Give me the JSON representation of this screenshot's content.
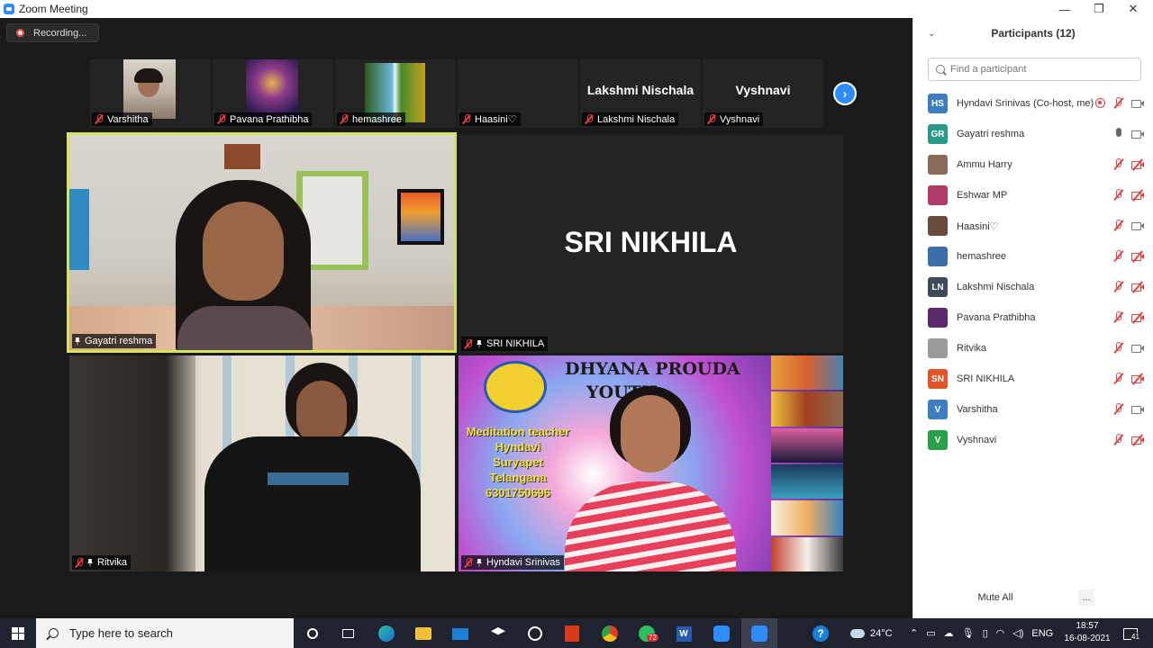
{
  "window": {
    "title": "Zoom Meeting"
  },
  "recording": {
    "label": "Recording..."
  },
  "strip": [
    {
      "name": "Varshitha",
      "type": "video",
      "color": "#b9b2a8"
    },
    {
      "name": "Pavana Prathibha",
      "type": "image",
      "color": "#5b3c82"
    },
    {
      "name": "hemashree",
      "type": "image",
      "color": "#3b7d3a"
    },
    {
      "name": "Haasini♡",
      "type": "blank",
      "color": "#232323"
    },
    {
      "name": "Lakshmi Nischala",
      "type": "text",
      "display": "Lakshmi Nischala"
    },
    {
      "name": "Vyshnavi",
      "type": "text",
      "display": "Vyshnavi"
    }
  ],
  "videos": {
    "gayatri": {
      "name": "Gayatri reshma"
    },
    "sri_nikhila": {
      "name": "SRI NIKHILA",
      "display": "SRI NIKHILA"
    },
    "ritvika": {
      "name": "Ritvika"
    },
    "hyndavi": {
      "name": "Hyndavi Srinivas",
      "banner_title": "DHYANA PROUDA",
      "banner_title2": "YOUTH",
      "banner_lines": [
        "Meditation teacher",
        "Hyndavi",
        "Suryapet",
        "Telangana",
        "6301750696"
      ]
    }
  },
  "panel": {
    "header": "Participants (12)",
    "search_placeholder": "Find a participant",
    "participants": [
      {
        "name": "Hyndavi Srinivas (Co-host, me)",
        "initials": "HS",
        "color": "#3d7dc0",
        "mic": "muted",
        "cam": "on",
        "rec": true
      },
      {
        "name": "Gayatri reshma",
        "initials": "GR",
        "color": "#2a9a86",
        "mic": "on",
        "cam": "on",
        "rec": false
      },
      {
        "name": "Ammu Harry",
        "initials": "",
        "color": "#8a6b5a",
        "mic": "muted",
        "cam": "off",
        "rec": false
      },
      {
        "name": "Eshwar MP",
        "initials": "",
        "color": "#b03a6a",
        "mic": "muted",
        "cam": "off",
        "rec": false
      },
      {
        "name": "Haasini♡",
        "initials": "",
        "color": "#6a4a3a",
        "mic": "muted",
        "cam": "on",
        "rec": false
      },
      {
        "name": "hemashree",
        "initials": "",
        "color": "#3b6fa8",
        "mic": "muted",
        "cam": "off",
        "rec": false
      },
      {
        "name": "Lakshmi Nischala",
        "initials": "LN",
        "color": "#3e4a5a",
        "mic": "muted",
        "cam": "off",
        "rec": false
      },
      {
        "name": "Pavana Prathibha",
        "initials": "",
        "color": "#5b2a6a",
        "mic": "muted",
        "cam": "off",
        "rec": false
      },
      {
        "name": "Ritvika",
        "initials": "",
        "color": "#9a9a9a",
        "mic": "muted",
        "cam": "on",
        "rec": false
      },
      {
        "name": "SRI NIKHILA",
        "initials": "SN",
        "color": "#e0562a",
        "mic": "muted",
        "cam": "off",
        "rec": false
      },
      {
        "name": "Varshitha",
        "initials": "V",
        "color": "#3d7dc0",
        "mic": "muted",
        "cam": "on",
        "rec": false
      },
      {
        "name": "Vyshnavi",
        "initials": "V",
        "color": "#2aa04a",
        "mic": "muted",
        "cam": "off",
        "rec": false
      }
    ],
    "mute_all": "Mute All",
    "more": "..."
  },
  "taskbar": {
    "search_placeholder": "Type here to search",
    "weather": "24°C",
    "lang": "ENG",
    "time": "18:57",
    "date": "16-08-2021",
    "whatsapp_badge": "72",
    "notification_count": "41"
  }
}
